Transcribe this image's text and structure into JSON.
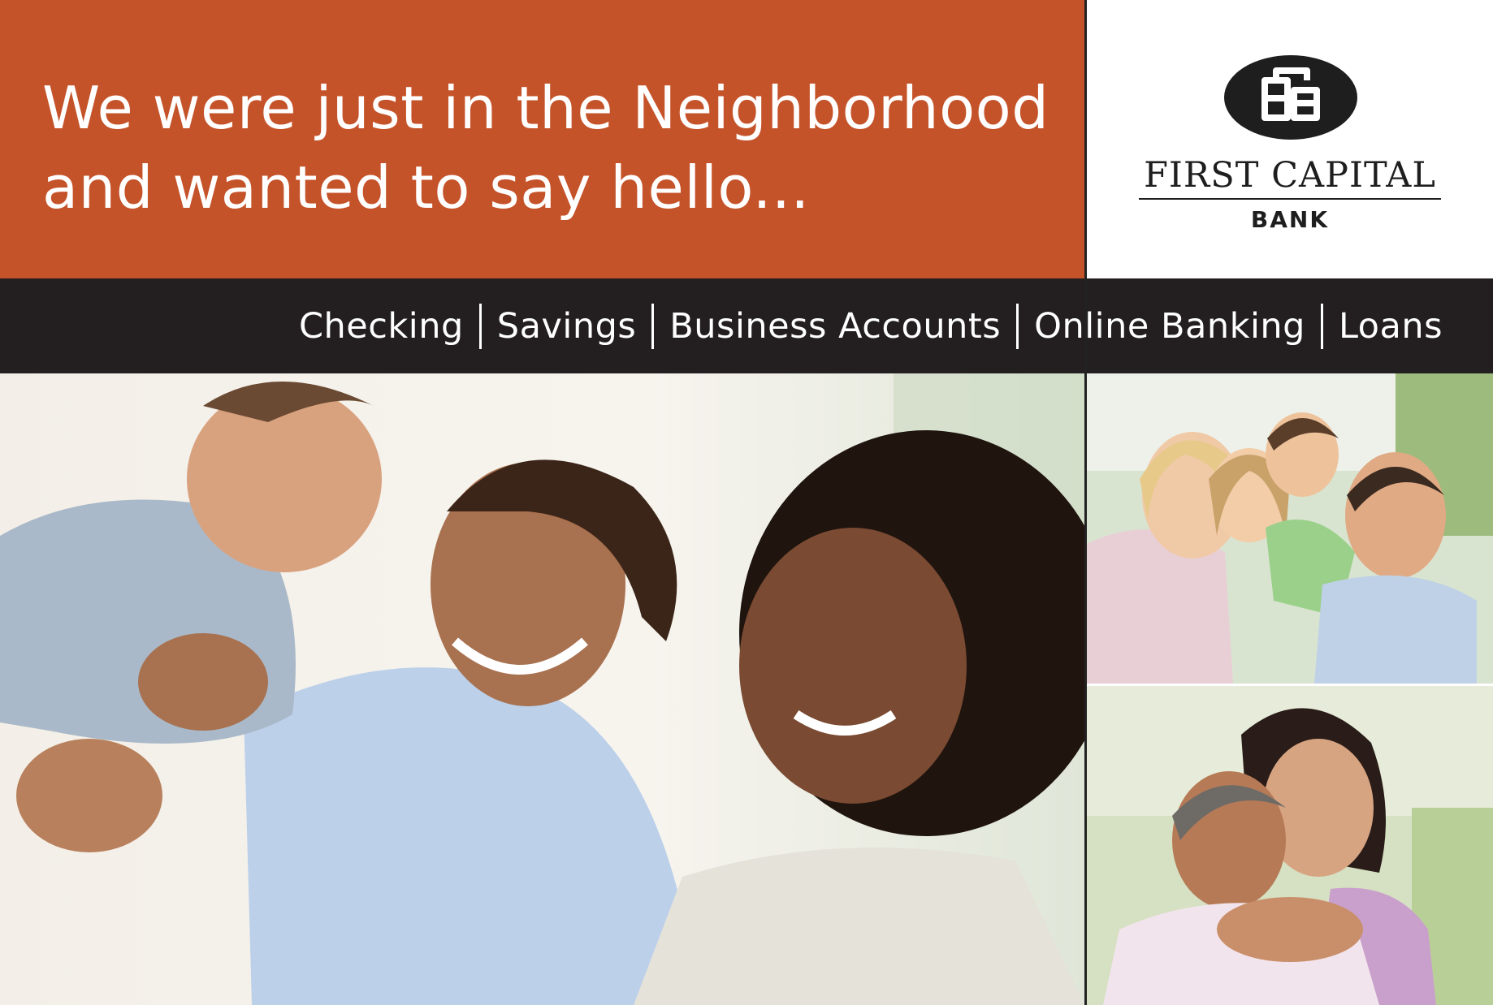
{
  "headline": {
    "line1": "We were just in the Neighborhood",
    "line2": "and wanted to say hello..."
  },
  "logo": {
    "name": "FIRST CAPITAL",
    "sub": "BANK"
  },
  "nav": {
    "items": [
      "Checking",
      "Savings",
      "Business Accounts",
      "Online Banking",
      "Loans"
    ]
  },
  "colors": {
    "banner": "#c5532a",
    "nav_bar": "#231f20",
    "text_light": "#ffffff",
    "logo_dark": "#1e1e1e"
  },
  "images": {
    "main": "family-with-baby-photo",
    "top_right": "family-piggyback-photo",
    "bottom_right": "senior-couple-photo"
  }
}
